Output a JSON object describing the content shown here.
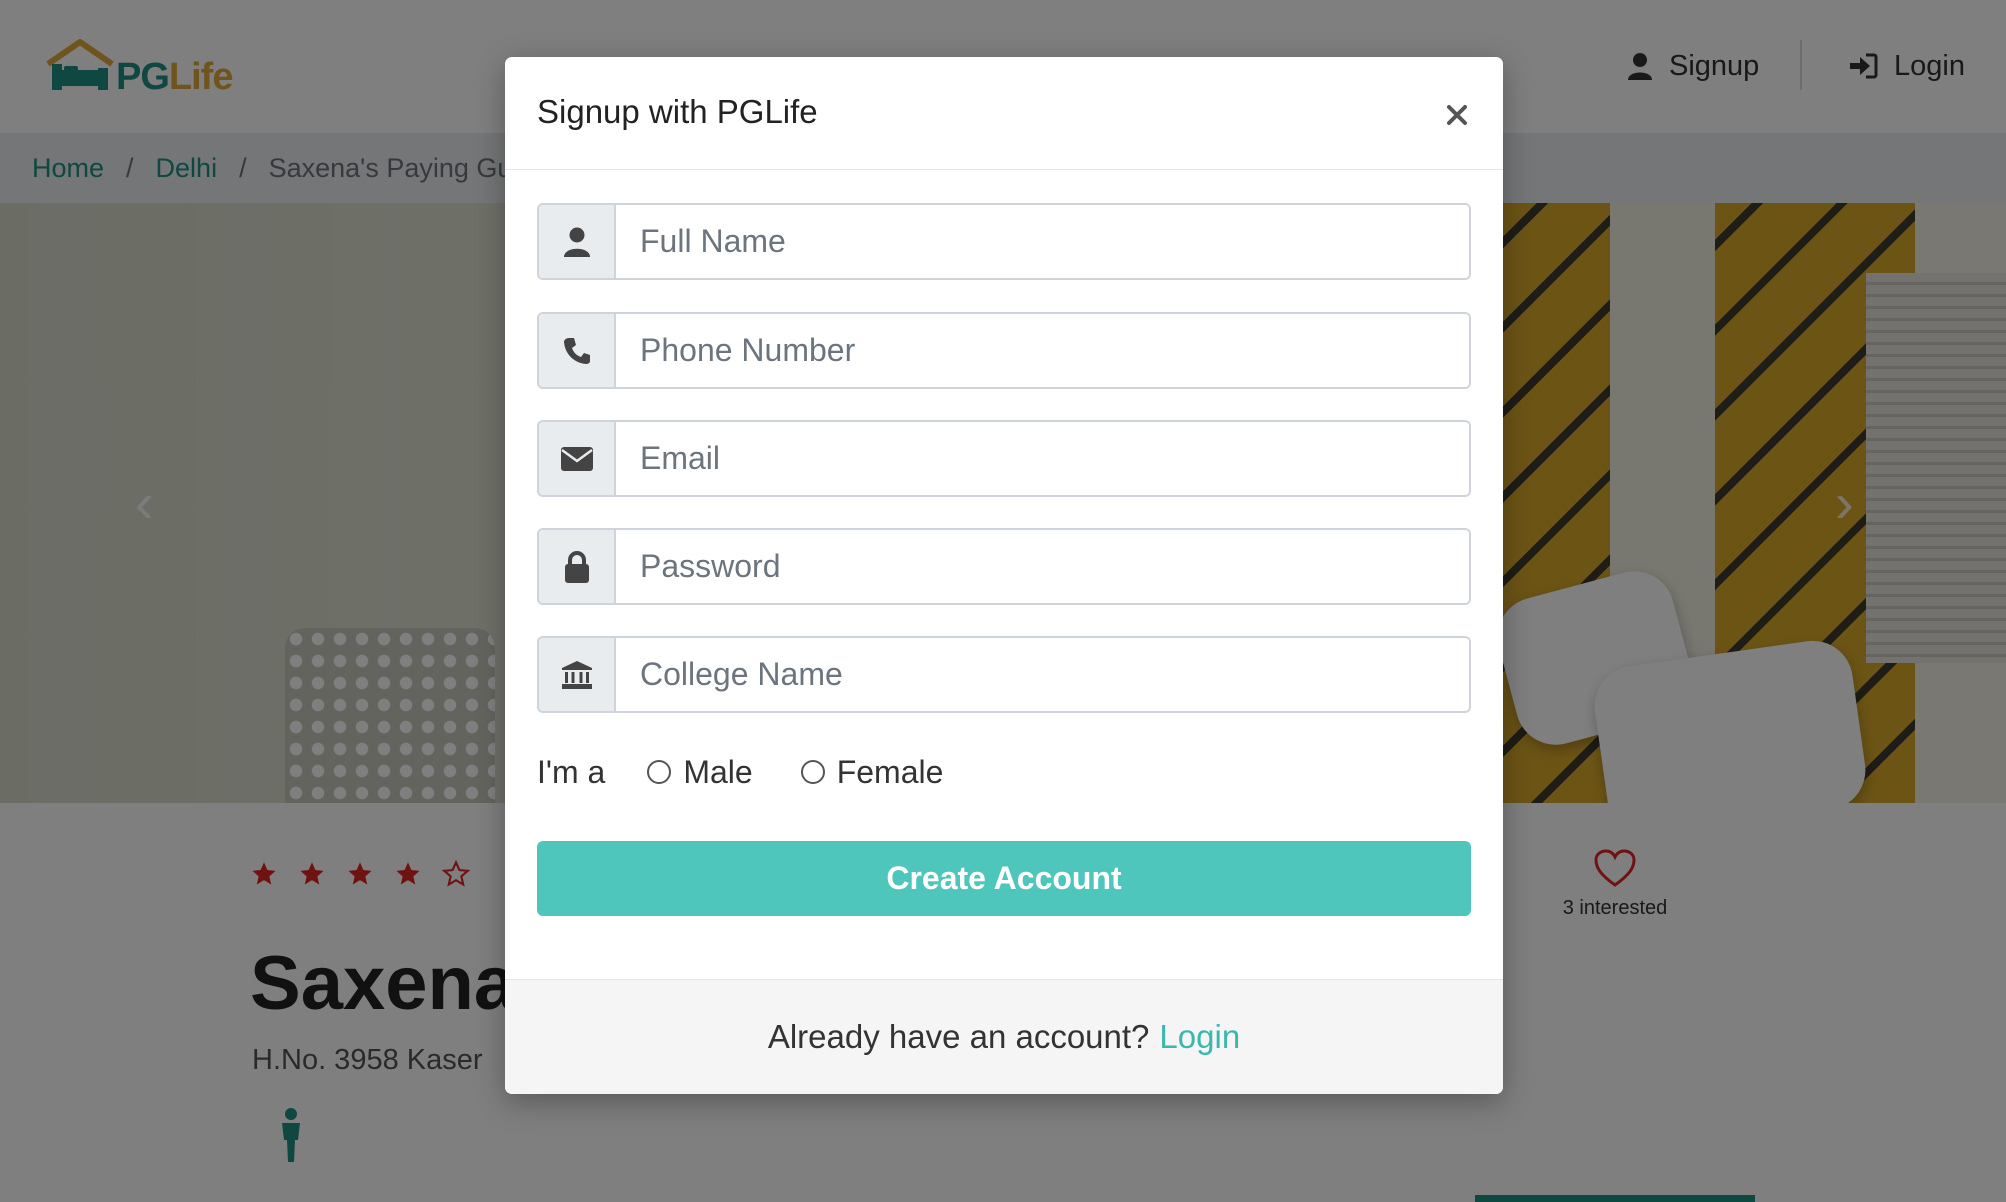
{
  "brand": {
    "logo_pg": "PG",
    "logo_life": "Life",
    "primary_color": "#1f8f83",
    "accent_color": "#e0a93a"
  },
  "nav": {
    "signup_label": "Signup",
    "login_label": "Login"
  },
  "breadcrumb": {
    "home": "Home",
    "city": "Delhi",
    "current": "Saxena's Paying Gue",
    "separator": "/"
  },
  "property": {
    "rating_stars": 4,
    "rating_max": 5,
    "title": "Saxena",
    "address": "H.No. 3958 Kaser",
    "interested_count": "3 interested"
  },
  "modal": {
    "title": "Signup with PGLife",
    "close_label": "×",
    "fields": {
      "full_name_placeholder": "Full Name",
      "phone_placeholder": "Phone Number",
      "email_placeholder": "Email",
      "password_placeholder": "Password",
      "college_placeholder": "College Name"
    },
    "gender_label": "I'm a",
    "gender_options": {
      "male": "Male",
      "female": "Female"
    },
    "submit_label": "Create Account",
    "button_color": "#4fc6bb",
    "footer_text": "Already have an account?",
    "footer_link": "Login"
  }
}
